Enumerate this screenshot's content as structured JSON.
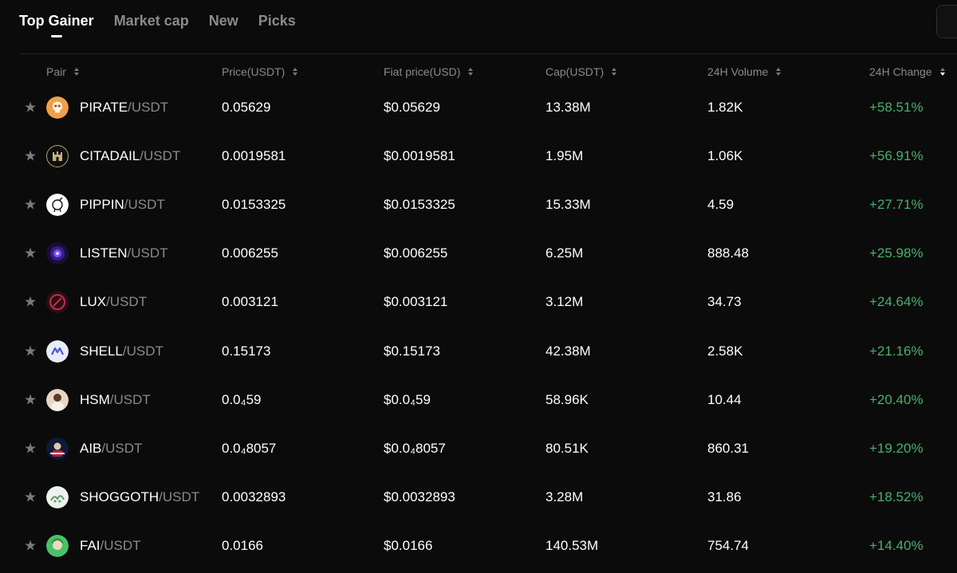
{
  "tabs": [
    {
      "label": "Top Gainer",
      "active": true
    },
    {
      "label": "Market cap",
      "active": false
    },
    {
      "label": "New",
      "active": false
    },
    {
      "label": "Picks",
      "active": false
    }
  ],
  "columns": {
    "pair": "Pair",
    "price": "Price(USDT)",
    "fiat": "Fiat price(USD)",
    "cap": "Cap(USDT)",
    "volume": "24H Volume",
    "change": "24H Change"
  },
  "colors": {
    "background": "#0b0b0b",
    "positive": "#4caf69",
    "muted": "#8a8a8a"
  },
  "rows": [
    {
      "base": "PIRATE",
      "quote": "/USDT",
      "price": "0.05629",
      "fiat": "$0.05629",
      "cap": "13.38M",
      "volume": "1.82K",
      "change": "+58.51%",
      "icon": "pirate-skull-icon"
    },
    {
      "base": "CITADAIL",
      "quote": "/USDT",
      "price": "0.0019581",
      "fiat": "$0.0019581",
      "cap": "1.95M",
      "volume": "1.06K",
      "change": "+56.91%",
      "icon": "citadail-castle-icon"
    },
    {
      "base": "PIPPIN",
      "quote": "/USDT",
      "price": "0.0153325",
      "fiat": "$0.0153325",
      "cap": "15.33M",
      "volume": "4.59",
      "change": "+27.71%",
      "icon": "pippin-unicorn-icon"
    },
    {
      "base": "LISTEN",
      "quote": "/USDT",
      "price": "0.006255",
      "fiat": "$0.006255",
      "cap": "6.25M",
      "volume": "888.48",
      "change": "+25.98%",
      "icon": "listen-eye-icon"
    },
    {
      "base": "LUX",
      "quote": "/USDT",
      "price": "0.003121",
      "fiat": "$0.003121",
      "cap": "3.12M",
      "volume": "34.73",
      "change": "+24.64%",
      "icon": "lux-logo-icon"
    },
    {
      "base": "SHELL",
      "quote": "/USDT",
      "price": "0.15173",
      "fiat": "$0.15173",
      "cap": "42.38M",
      "volume": "2.58K",
      "change": "+21.16%",
      "icon": "shell-logo-icon"
    },
    {
      "base": "HSM",
      "quote": "/USDT",
      "price": "0.0₄59",
      "fiat": "$0.0₄59",
      "cap": "58.96K",
      "volume": "10.44",
      "change": "+20.40%",
      "icon": "hsm-avatar-icon"
    },
    {
      "base": "AIB",
      "quote": "/USDT",
      "price": "0.0₄8057",
      "fiat": "$0.0₄8057",
      "cap": "80.51K",
      "volume": "860.31",
      "change": "+19.20%",
      "icon": "aib-avatar-icon"
    },
    {
      "base": "SHOGGOTH",
      "quote": "/USDT",
      "price": "0.0032893",
      "fiat": "$0.0032893",
      "cap": "3.28M",
      "volume": "31.86",
      "change": "+18.52%",
      "icon": "shoggoth-logo-icon"
    },
    {
      "base": "FAI",
      "quote": "/USDT",
      "price": "0.0166",
      "fiat": "$0.0166",
      "cap": "140.53M",
      "volume": "754.74",
      "change": "+14.40%",
      "icon": "fai-avatar-icon"
    }
  ]
}
